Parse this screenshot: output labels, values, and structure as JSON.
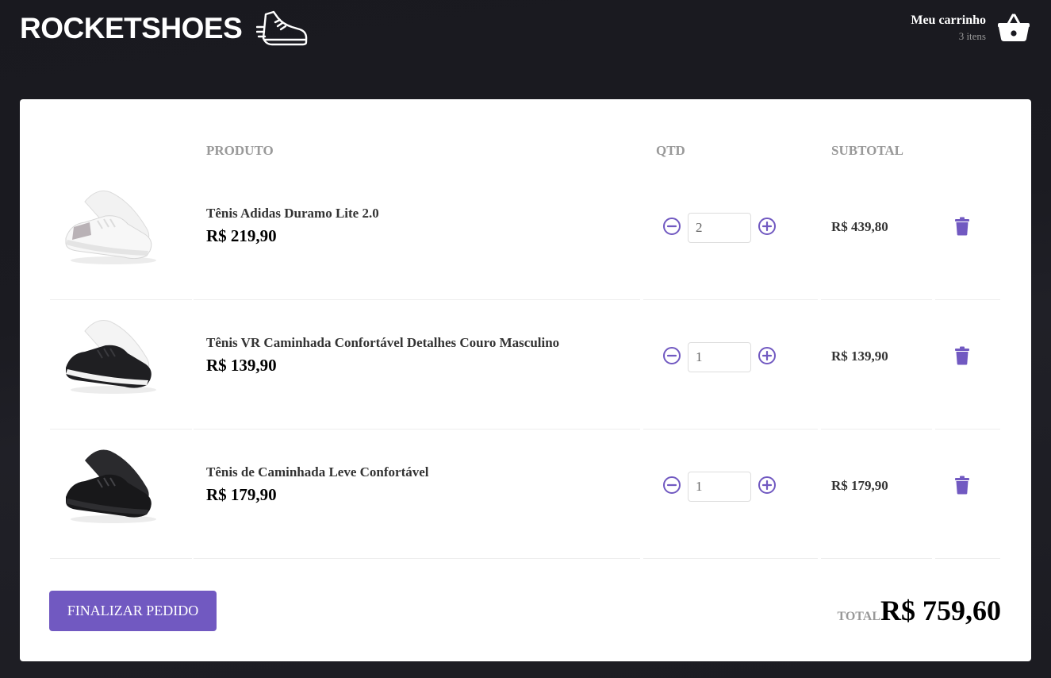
{
  "header": {
    "logo_text": "ROCKETSHOES",
    "cart_title": "Meu carrinho",
    "cart_count": "3 itens"
  },
  "table": {
    "headers": {
      "product": "PRODUTO",
      "quantity": "QTD",
      "subtotal": "SUBTOTAL"
    },
    "items": [
      {
        "name": "Tênis Adidas Duramo Lite 2.0",
        "price": "R$ 219,90",
        "quantity": "2",
        "subtotal": "R$ 439,80",
        "shoe_color": "white"
      },
      {
        "name": "Tênis VR Caminhada Confortável Detalhes Couro Masculino",
        "price": "R$ 139,90",
        "quantity": "1",
        "subtotal": "R$ 139,90",
        "shoe_color": "black-white-sole"
      },
      {
        "name": "Tênis de Caminhada Leve Confortável",
        "price": "R$ 179,90",
        "quantity": "1",
        "subtotal": "R$ 179,90",
        "shoe_color": "black"
      }
    ]
  },
  "footer": {
    "checkout_label": "FINALIZAR PEDIDO",
    "total_label": "TOTAL",
    "total_value": "R$ 759,60"
  },
  "icons": {
    "logo": "running-shoe-icon",
    "cart": "basket-icon",
    "decrement": "minus-circle-icon",
    "increment": "plus-circle-icon",
    "remove": "trash-icon"
  },
  "colors": {
    "accent": "#7159c1",
    "background": "#191920",
    "card": "#ffffff"
  }
}
